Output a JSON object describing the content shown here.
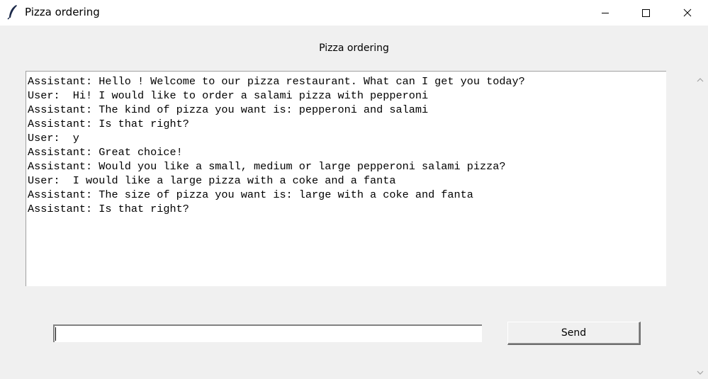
{
  "window": {
    "title": "Pizza ordering",
    "app_icon": "feather-icon",
    "controls": {
      "minimize": "minimize-icon",
      "maximize": "maximize-icon",
      "close": "close-icon"
    }
  },
  "header": {
    "title": "Pizza ordering"
  },
  "chat": {
    "lines": [
      "Assistant: Hello ! Welcome to our pizza restaurant. What can I get you today?",
      "User:  Hi! I would like to order a salami pizza with pepperoni",
      "Assistant: The kind of pizza you want is: pepperoni and salami",
      "Assistant: Is that right?",
      "User:  y",
      "Assistant: Great choice!",
      "Assistant: Would you like a small, medium or large pepperoni salami pizza?",
      "User:  I would like a large pizza with a coke and a fanta",
      "Assistant: The size of pizza you want is: large with a coke and fanta",
      "Assistant: Is that right?"
    ]
  },
  "input": {
    "value": ""
  },
  "send_button": {
    "label": "Send"
  }
}
